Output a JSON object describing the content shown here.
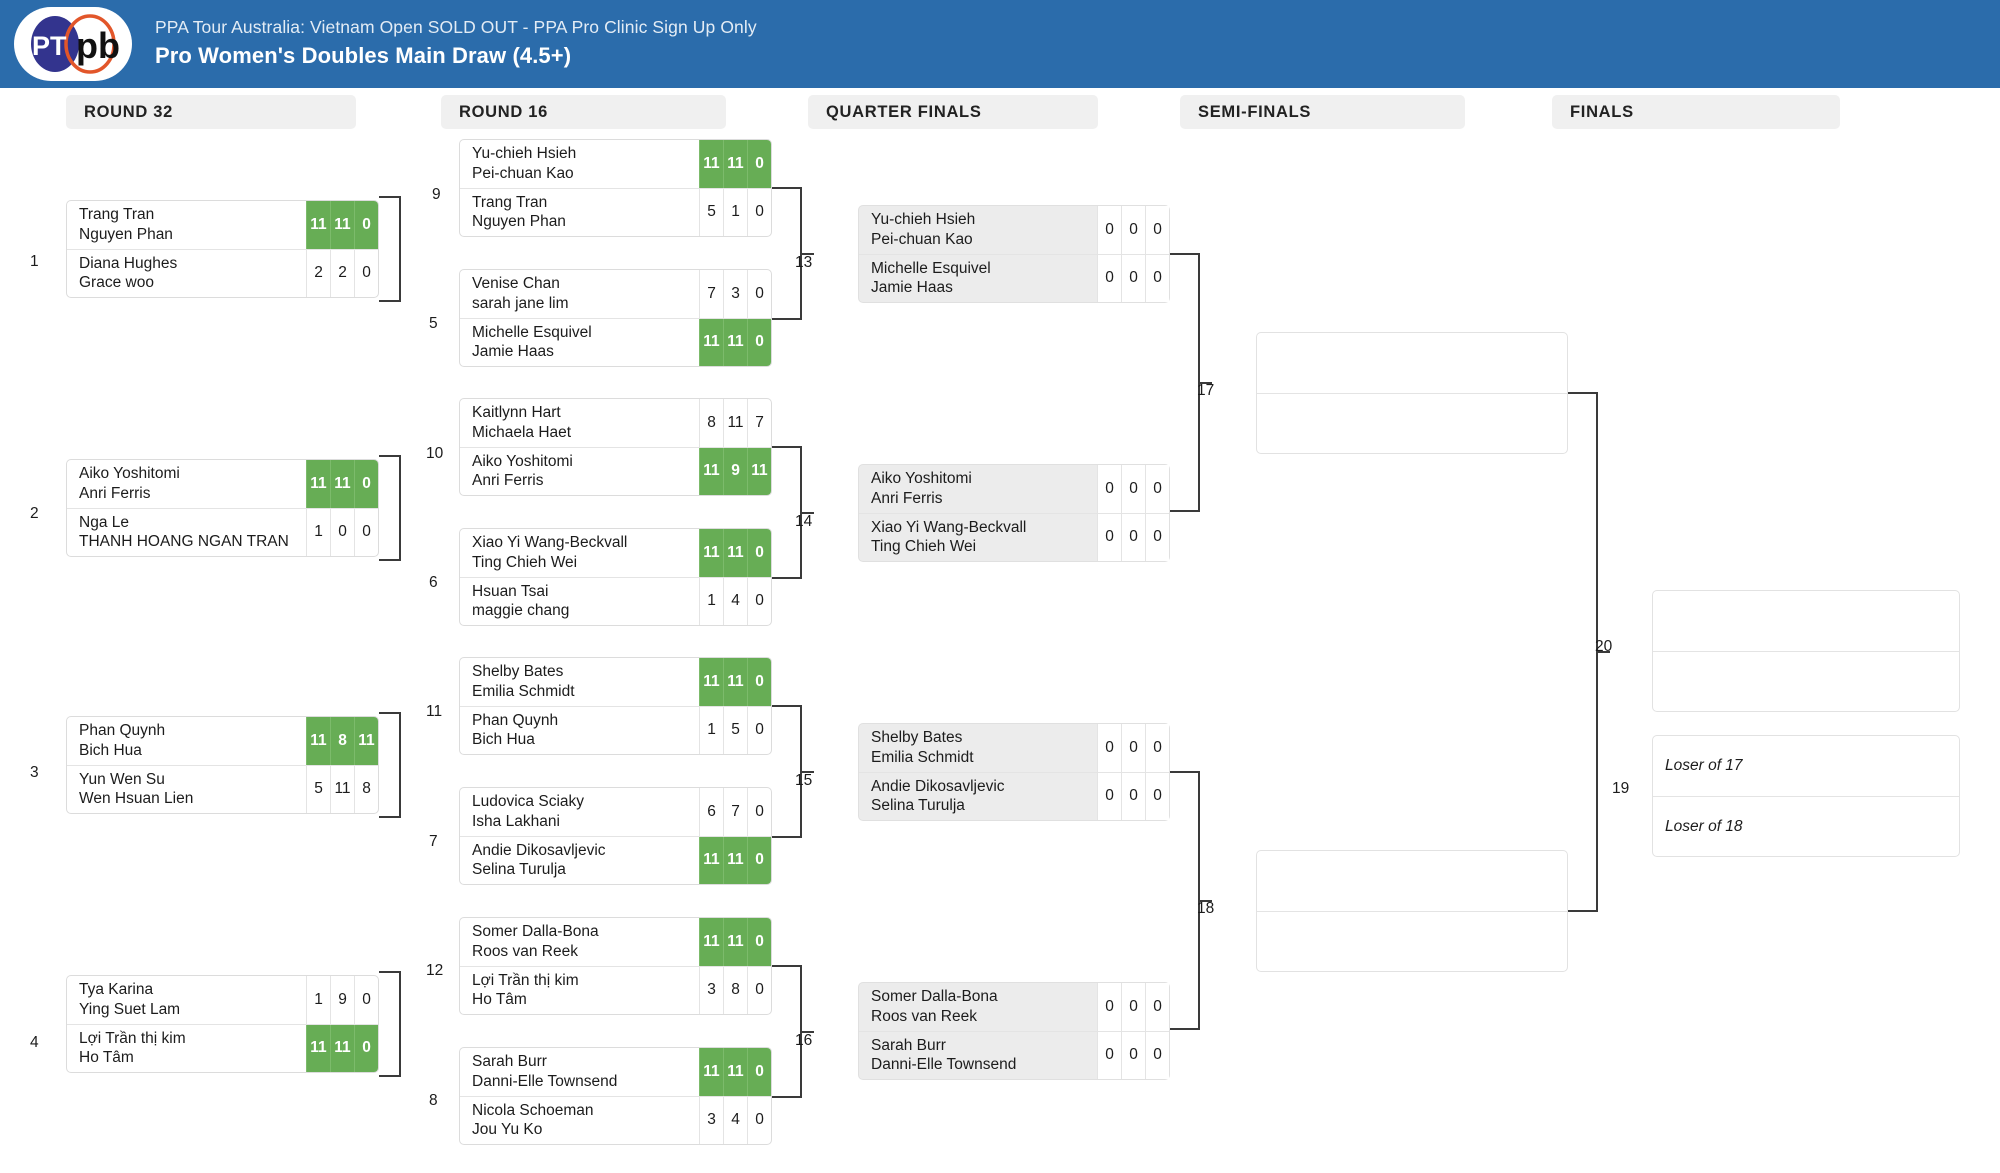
{
  "header": {
    "event_name": "PPA Tour Australia: Vietnam Open SOLD OUT - PPA Pro Clinic Sign Up Only",
    "draw_name": "Pro Women's Doubles Main Draw (4.5+)",
    "logo_text": "pb",
    "logo_mark": "PT",
    "brand_blue": "#2b6cab",
    "winner_green": "#67ad55"
  },
  "rounds": [
    {
      "id": "round32",
      "label": "ROUND 32"
    },
    {
      "id": "round16",
      "label": "ROUND 16"
    },
    {
      "id": "quarters",
      "label": "QUARTER FINALS"
    },
    {
      "id": "semis",
      "label": "SEMI-FINALS"
    },
    {
      "id": "finals",
      "label": "FINALS"
    }
  ],
  "seeds": [
    "1",
    "2",
    "3",
    "4"
  ],
  "match_numbers": {
    "m5": "5",
    "m6": "6",
    "m7": "7",
    "m8": "8",
    "m9": "9",
    "m10": "10",
    "m11": "11",
    "m12": "12",
    "m13": "13",
    "m14": "14",
    "m15": "15",
    "m16": "16",
    "m17": "17",
    "m18": "18",
    "m19": "19",
    "m20": "20"
  },
  "round32": [
    {
      "number": "1",
      "top": {
        "p1": "Trang Tran",
        "p2": "Nguyen Phan",
        "scores": [
          "11",
          "11",
          "0"
        ],
        "winner": true
      },
      "bottom": {
        "p1": "Diana Hughes",
        "p2": "Grace woo",
        "scores": [
          "2",
          "2",
          "0"
        ],
        "winner": false
      }
    },
    {
      "number": "2",
      "top": {
        "p1": "Aiko Yoshitomi",
        "p2": "Anri Ferris",
        "scores": [
          "11",
          "11",
          "0"
        ],
        "winner": true
      },
      "bottom": {
        "p1": "Nga Le",
        "p2": "THANH HOANG NGAN TRAN",
        "scores": [
          "1",
          "0",
          "0"
        ],
        "winner": false
      }
    },
    {
      "number": "3",
      "top": {
        "p1": "Phan Quynh",
        "p2": "Bich Hua",
        "scores": [
          "11",
          "8",
          "11"
        ],
        "winner": true
      },
      "bottom": {
        "p1": "Yun Wen Su",
        "p2": "Wen Hsuan Lien",
        "scores": [
          "5",
          "11",
          "8"
        ],
        "winner": false
      }
    },
    {
      "number": "4",
      "top": {
        "p1": "Tya Karina",
        "p2": "Ying Suet Lam",
        "scores": [
          "1",
          "9",
          "0"
        ],
        "winner": false
      },
      "bottom": {
        "p1": "Lợi Trần thị kim",
        "p2": "Ho Tâm",
        "scores": [
          "11",
          "11",
          "0"
        ],
        "winner": true
      }
    }
  ],
  "round16": [
    {
      "number": "9",
      "top": {
        "p1": "Yu-chieh Hsieh",
        "p2": "Pei-chuan Kao",
        "scores": [
          "11",
          "11",
          "0"
        ],
        "winner": true
      },
      "bottom": {
        "p1": "Trang Tran",
        "p2": "Nguyen Phan",
        "scores": [
          "5",
          "1",
          "0"
        ],
        "winner": false
      }
    },
    {
      "number": "5",
      "top": {
        "p1": "Venise Chan",
        "p2": "sarah jane lim",
        "scores": [
          "7",
          "3",
          "0"
        ],
        "winner": false
      },
      "bottom": {
        "p1": "Michelle Esquivel",
        "p2": "Jamie Haas",
        "scores": [
          "11",
          "11",
          "0"
        ],
        "winner": true
      }
    },
    {
      "number": "10",
      "top": {
        "p1": "Kaitlynn Hart",
        "p2": "Michaela Haet",
        "scores": [
          "8",
          "11",
          "7"
        ],
        "winner": false
      },
      "bottom": {
        "p1": "Aiko Yoshitomi",
        "p2": "Anri Ferris",
        "scores": [
          "11",
          "9",
          "11"
        ],
        "winner": true
      }
    },
    {
      "number": "6",
      "top": {
        "p1": "Xiao Yi Wang-Beckvall",
        "p2": "Ting Chieh Wei",
        "scores": [
          "11",
          "11",
          "0"
        ],
        "winner": true
      },
      "bottom": {
        "p1": "Hsuan Tsai",
        "p2": "maggie chang",
        "scores": [
          "1",
          "4",
          "0"
        ],
        "winner": false
      }
    },
    {
      "number": "11",
      "top": {
        "p1": "Shelby Bates",
        "p2": "Emilia Schmidt",
        "scores": [
          "11",
          "11",
          "0"
        ],
        "winner": true
      },
      "bottom": {
        "p1": "Phan Quynh",
        "p2": "Bich Hua",
        "scores": [
          "1",
          "5",
          "0"
        ],
        "winner": false
      }
    },
    {
      "number": "7",
      "top": {
        "p1": "Ludovica Sciaky",
        "p2": "Isha Lakhani",
        "scores": [
          "6",
          "7",
          "0"
        ],
        "winner": false
      },
      "bottom": {
        "p1": "Andie Dikosavljevic",
        "p2": "Selina Turulja",
        "scores": [
          "11",
          "11",
          "0"
        ],
        "winner": true
      }
    },
    {
      "number": "12",
      "top": {
        "p1": "Somer Dalla-Bona",
        "p2": "Roos van Reek",
        "scores": [
          "11",
          "11",
          "0"
        ],
        "winner": true
      },
      "bottom": {
        "p1": "Lợi Trần thị kim",
        "p2": "Ho Tâm",
        "scores": [
          "3",
          "8",
          "0"
        ],
        "winner": false
      }
    },
    {
      "number": "8",
      "top": {
        "p1": "Sarah Burr",
        "p2": "Danni-Elle Townsend",
        "scores": [
          "11",
          "11",
          "0"
        ],
        "winner": true
      },
      "bottom": {
        "p1": "Nicola Schoeman",
        "p2": "Jou Yu Ko",
        "scores": [
          "3",
          "4",
          "0"
        ],
        "winner": false
      }
    }
  ],
  "quarters": [
    {
      "number": "13",
      "top": {
        "p1": "Yu-chieh Hsieh",
        "p2": "Pei-chuan Kao",
        "scores": [
          "0",
          "0",
          "0"
        ],
        "winner": false
      },
      "bottom": {
        "p1": "Michelle Esquivel",
        "p2": "Jamie Haas",
        "scores": [
          "0",
          "0",
          "0"
        ],
        "winner": false
      }
    },
    {
      "number": "14",
      "top": {
        "p1": "Aiko Yoshitomi",
        "p2": "Anri Ferris",
        "scores": [
          "0",
          "0",
          "0"
        ],
        "winner": false
      },
      "bottom": {
        "p1": "Xiao Yi Wang-Beckvall",
        "p2": "Ting Chieh Wei",
        "scores": [
          "0",
          "0",
          "0"
        ],
        "winner": false
      }
    },
    {
      "number": "15",
      "top": {
        "p1": "Shelby Bates",
        "p2": "Emilia Schmidt",
        "scores": [
          "0",
          "0",
          "0"
        ],
        "winner": false
      },
      "bottom": {
        "p1": "Andie Dikosavljevic",
        "p2": "Selina Turulja",
        "scores": [
          "0",
          "0",
          "0"
        ],
        "winner": false
      }
    },
    {
      "number": "16",
      "top": {
        "p1": "Somer Dalla-Bona",
        "p2": "Roos van Reek",
        "scores": [
          "0",
          "0",
          "0"
        ],
        "winner": false
      },
      "bottom": {
        "p1": "Sarah Burr",
        "p2": "Danni-Elle Townsend",
        "scores": [
          "0",
          "0",
          "0"
        ],
        "winner": false
      }
    }
  ],
  "semis": [
    {
      "number": "17",
      "top": {
        "p1": "",
        "p2": ""
      },
      "bottom": {
        "p1": "",
        "p2": ""
      }
    },
    {
      "number": "18",
      "top": {
        "p1": "",
        "p2": ""
      },
      "bottom": {
        "p1": "",
        "p2": ""
      }
    }
  ],
  "finals": {
    "number": "20",
    "top": {
      "p1": "",
      "p2": ""
    },
    "bottom": {
      "p1": "",
      "p2": ""
    }
  },
  "third_place": {
    "number": "19",
    "top": {
      "p1": "Loser of 17"
    },
    "bottom": {
      "p1": "Loser of 18"
    }
  }
}
